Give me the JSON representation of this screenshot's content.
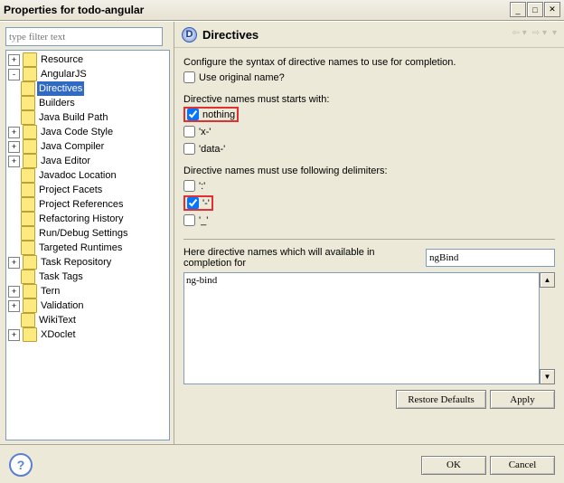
{
  "window": {
    "title": "Properties for todo-angular"
  },
  "filter": {
    "placeholder": "type filter text"
  },
  "tree": {
    "items": [
      {
        "exp": "+",
        "label": "Resource",
        "indent": 1
      },
      {
        "exp": "-",
        "label": "AngularJS",
        "indent": 1
      },
      {
        "exp": "",
        "label": "Directives",
        "indent": 2,
        "selected": true
      },
      {
        "exp": "",
        "label": "Builders",
        "indent": 1
      },
      {
        "exp": "",
        "label": "Java Build Path",
        "indent": 1
      },
      {
        "exp": "+",
        "label": "Java Code Style",
        "indent": 1
      },
      {
        "exp": "+",
        "label": "Java Compiler",
        "indent": 1
      },
      {
        "exp": "+",
        "label": "Java Editor",
        "indent": 1
      },
      {
        "exp": "",
        "label": "Javadoc Location",
        "indent": 1
      },
      {
        "exp": "",
        "label": "Project Facets",
        "indent": 1
      },
      {
        "exp": "",
        "label": "Project References",
        "indent": 1
      },
      {
        "exp": "",
        "label": "Refactoring History",
        "indent": 1
      },
      {
        "exp": "",
        "label": "Run/Debug Settings",
        "indent": 1
      },
      {
        "exp": "",
        "label": "Targeted Runtimes",
        "indent": 1
      },
      {
        "exp": "+",
        "label": "Task Repository",
        "indent": 1
      },
      {
        "exp": "",
        "label": "Task Tags",
        "indent": 1
      },
      {
        "exp": "+",
        "label": "Tern",
        "indent": 1
      },
      {
        "exp": "+",
        "label": "Validation",
        "indent": 1
      },
      {
        "exp": "",
        "label": "WikiText",
        "indent": 1
      },
      {
        "exp": "+",
        "label": "XDoclet",
        "indent": 1
      }
    ]
  },
  "page": {
    "title": "Directives",
    "intro": "Configure the syntax of directive names to use for completion.",
    "useOriginal": {
      "checked": false,
      "label": "Use original name?"
    },
    "startsWithLabel": "Directive names must starts with:",
    "startsWith": [
      {
        "checked": true,
        "label": "nothing",
        "hl": true
      },
      {
        "checked": false,
        "label": "'x-'"
      },
      {
        "checked": false,
        "label": "'data-'"
      }
    ],
    "delimLabel": "Directive names must use following delimiters:",
    "delim": [
      {
        "checked": false,
        "label": "':'"
      },
      {
        "checked": true,
        "label": "'-'",
        "hl": true
      },
      {
        "checked": false,
        "label": "'_'"
      }
    ],
    "exampleLeft": "Here directive names which will available in completion for",
    "exampleInput": "ngBind",
    "exampleOutput": "ng-bind",
    "buttons": {
      "restore": "Restore Defaults",
      "apply": "Apply",
      "ok": "OK",
      "cancel": "Cancel"
    }
  }
}
